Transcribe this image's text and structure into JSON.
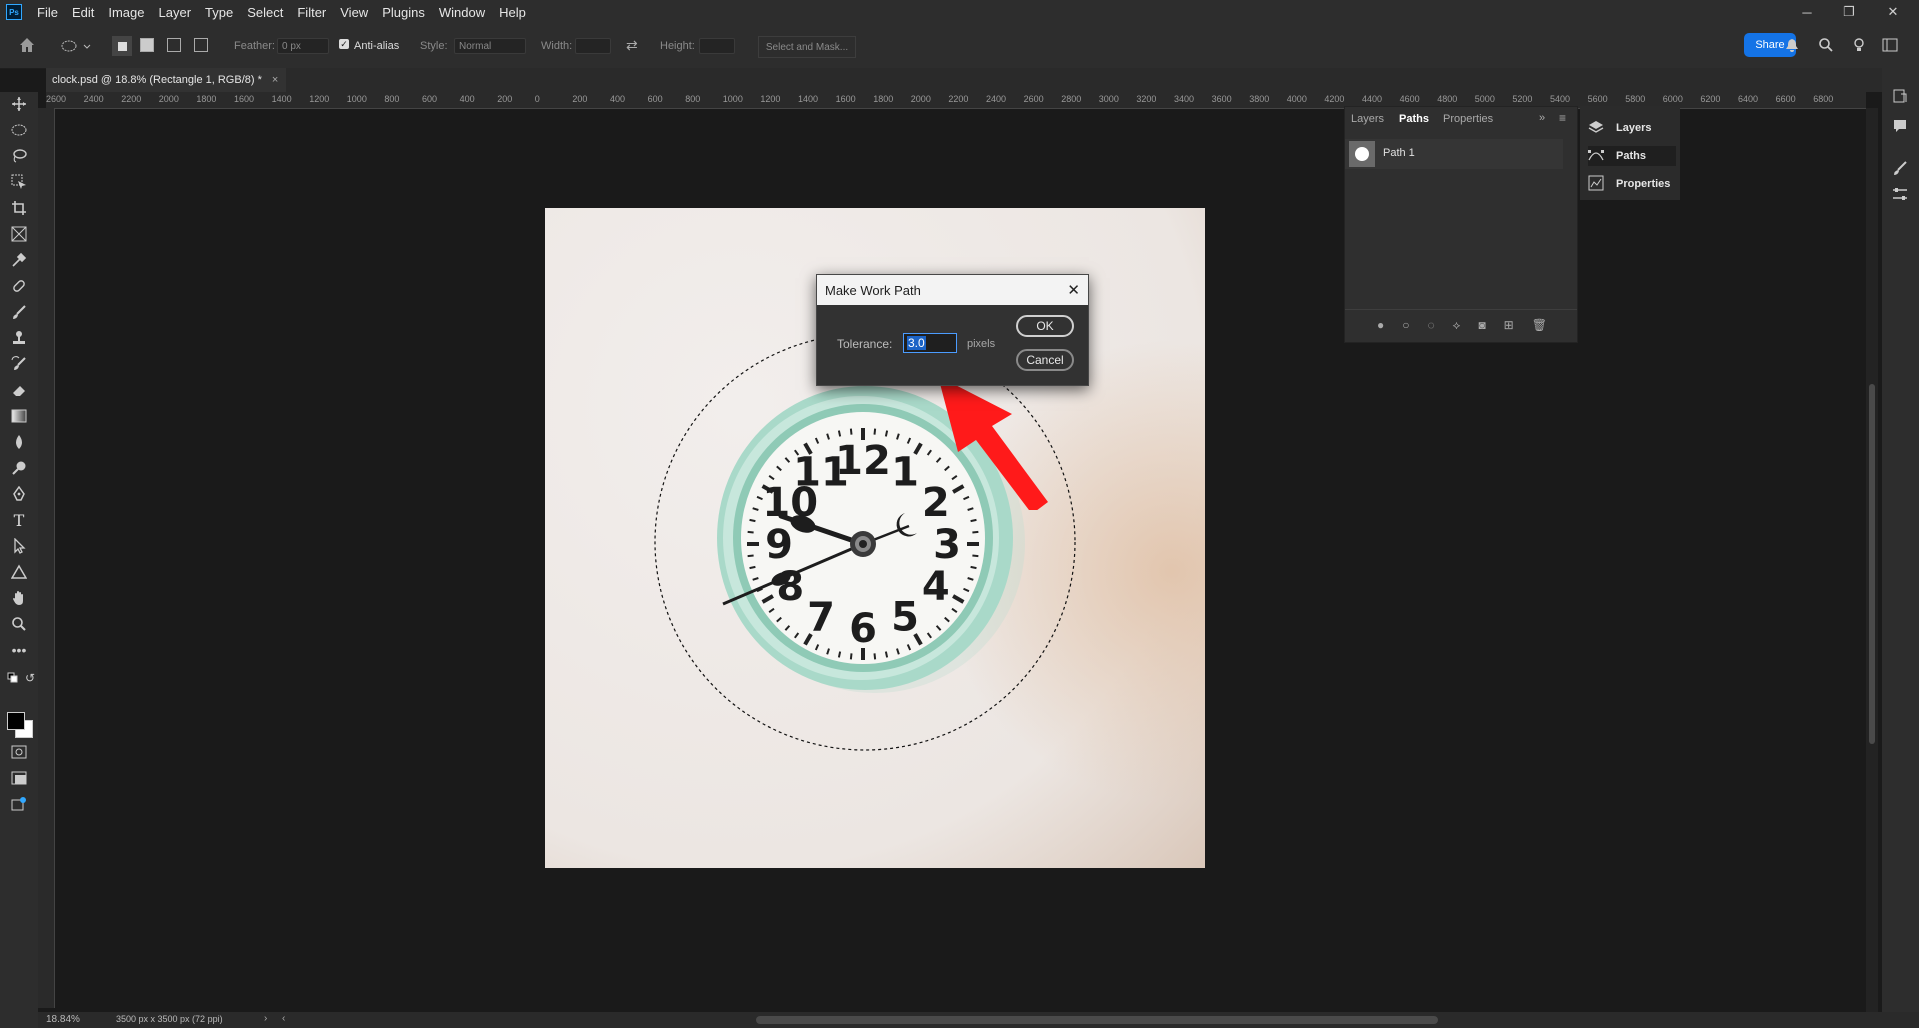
{
  "menubar": {
    "app_icon": "Ps",
    "items": [
      "File",
      "Edit",
      "Image",
      "Layer",
      "Type",
      "Select",
      "Filter",
      "View",
      "Plugins",
      "Window",
      "Help"
    ]
  },
  "options": {
    "feather_label": "Feather:",
    "feather_value": "0 px",
    "antialias_label": "Anti-alias",
    "style_label": "Style:",
    "style_value": "Normal",
    "width_label": "Width:",
    "height_label": "Height:",
    "select_mask": "Select and Mask...",
    "share": "Share"
  },
  "document": {
    "tab_title": "clock.psd @ 18.8% (Rectangle 1, RGB/8) *",
    "close": "×"
  },
  "ruler": {
    "labels": [
      "2600",
      "2400",
      "2200",
      "2000",
      "1800",
      "1600",
      "1400",
      "1200",
      "1000",
      "800",
      "600",
      "400",
      "200",
      "0",
      "200",
      "400",
      "600",
      "800",
      "1000",
      "1200",
      "1400",
      "1600",
      "1800",
      "2000",
      "2200",
      "2400",
      "2600",
      "2800",
      "3000",
      "3200",
      "3400",
      "3600",
      "3800",
      "4000",
      "4200",
      "4400",
      "4600",
      "4800",
      "5000",
      "5200",
      "5400",
      "5600",
      "5800",
      "6000",
      "6200",
      "6400",
      "6600",
      "6800"
    ]
  },
  "dialog": {
    "title": "Make Work Path",
    "tolerance_label": "Tolerance:",
    "tolerance_value": "3.0",
    "unit": "pixels",
    "ok": "OK",
    "cancel": "Cancel"
  },
  "paths_panel": {
    "tabs": [
      "Layers",
      "Paths",
      "Properties"
    ],
    "active_tab": "Paths",
    "rows": [
      {
        "name": "Path 1"
      }
    ]
  },
  "collapsed_panel": {
    "items": [
      "Layers",
      "Paths",
      "Properties"
    ]
  },
  "clock": {
    "numerals": [
      "12",
      "1",
      "2",
      "3",
      "4",
      "5",
      "6",
      "7",
      "8",
      "9",
      "10",
      "11"
    ]
  },
  "status": {
    "zoom": "18.84%",
    "doc_info": "3500 px x 3500 px (72 ppi)"
  },
  "colors": {
    "accent": "#1473e6",
    "arrow": "#ff1a1a",
    "selection_text_bg": "#1b63c6"
  }
}
